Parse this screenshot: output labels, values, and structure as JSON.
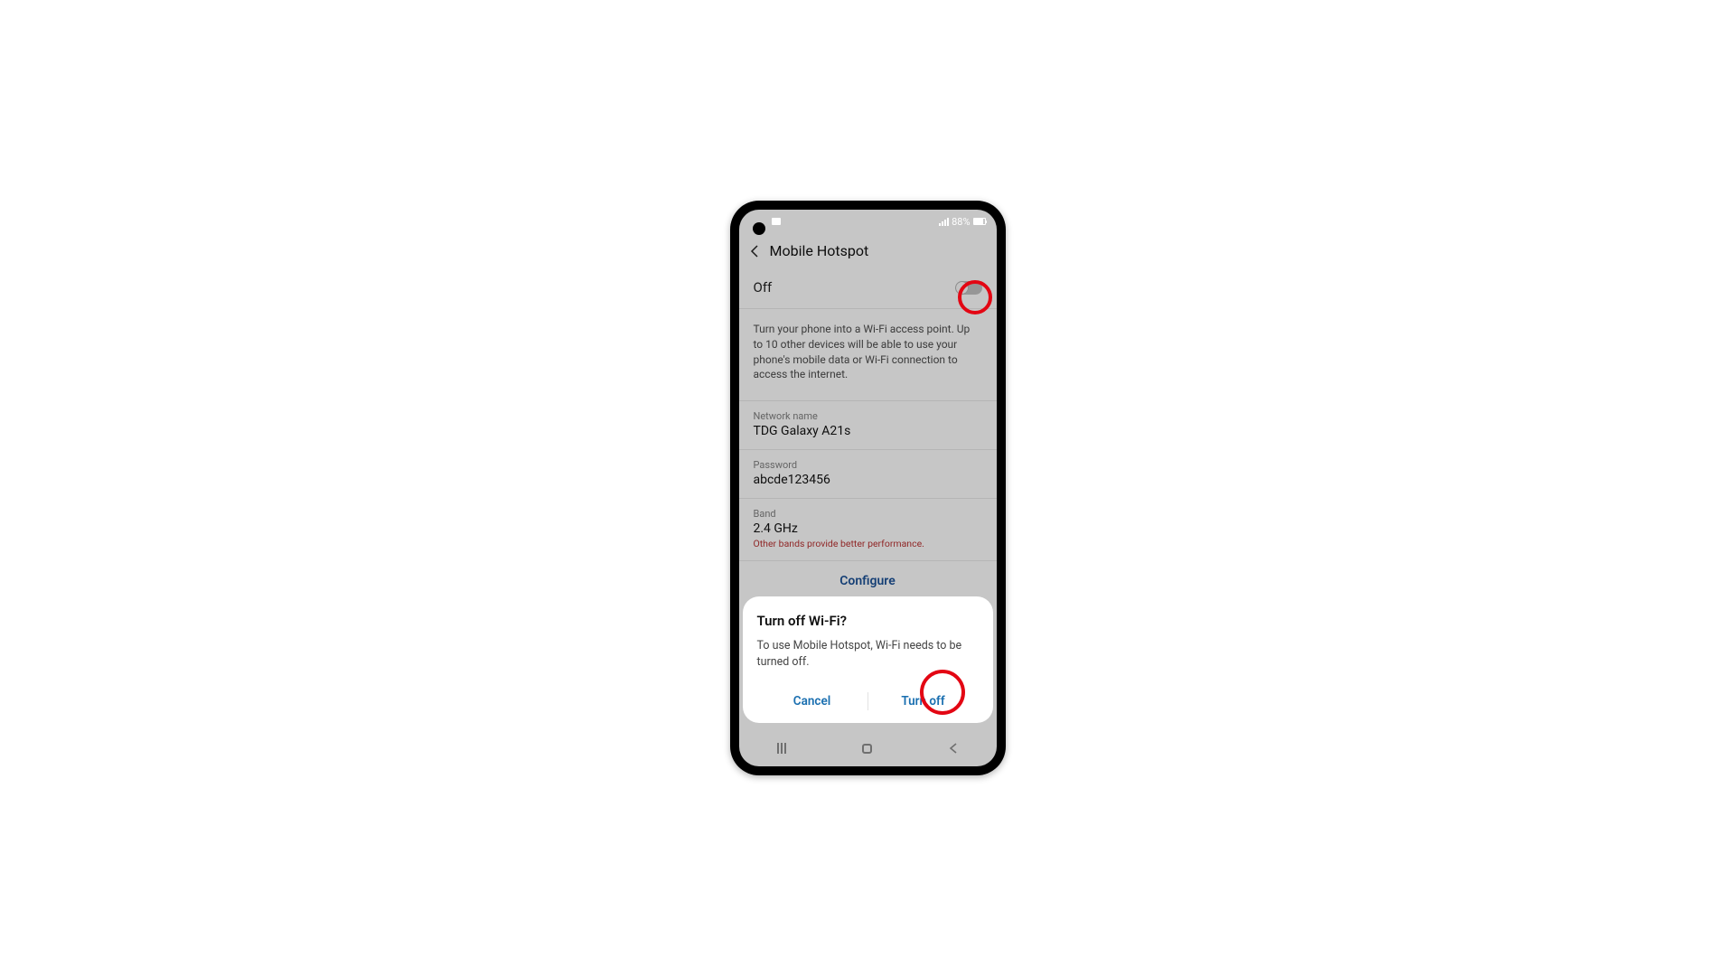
{
  "status": {
    "battery_pct": "88%",
    "icons": {
      "video": "video-icon",
      "signal": "signal-icon",
      "battery": "battery-icon"
    }
  },
  "header": {
    "title": "Mobile Hotspot"
  },
  "toggle": {
    "state_label": "Off"
  },
  "description": "Turn your phone into a Wi-Fi access point. Up to 10 other devices will be able to use your phone's mobile data or Wi-Fi connection to access the internet.",
  "network": {
    "name_label": "Network name",
    "name_value": "TDG Galaxy A21s",
    "password_label": "Password",
    "password_value": "abcde123456",
    "band_label": "Band",
    "band_value": "2.4 GHz",
    "band_warning": "Other bands provide better performance."
  },
  "configure_label": "Configure",
  "dialog": {
    "title": "Turn off Wi-Fi?",
    "body": "To use Mobile Hotspot, Wi-Fi needs to be turned off.",
    "cancel": "Cancel",
    "confirm": "Turn off"
  }
}
